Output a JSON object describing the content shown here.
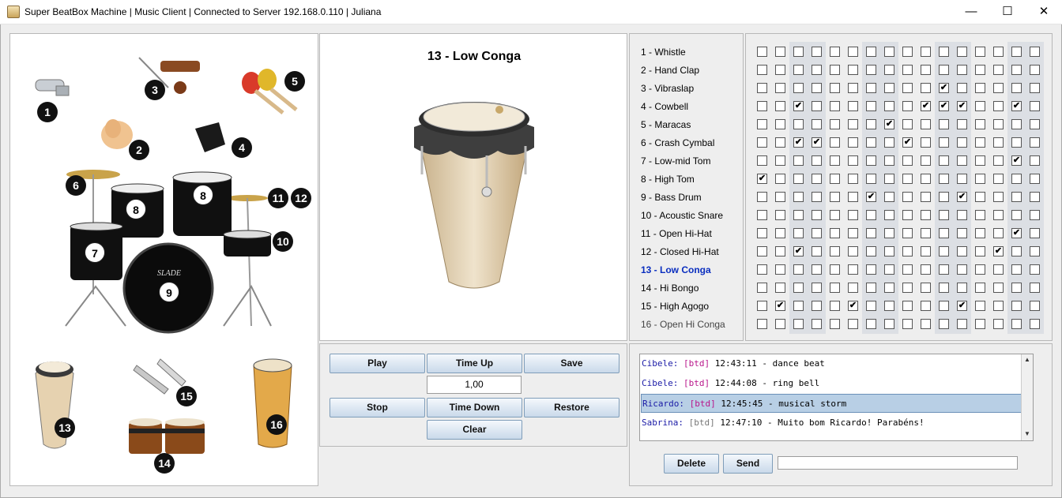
{
  "window": {
    "title": "Super BeatBox Machine | Music Client | Connected to Server 192.168.0.110 | Juliana",
    "minimize": "—",
    "maximize": "☐",
    "close": "✕"
  },
  "instrument_map": {
    "numbers": [
      "1",
      "2",
      "3",
      "4",
      "5",
      "6",
      "7",
      "8",
      "8",
      "9",
      "10",
      "11",
      "12",
      "13",
      "14",
      "15",
      "16"
    ],
    "drum_logo": "SLADE"
  },
  "preview": {
    "title": "13 - Low Conga"
  },
  "controls": {
    "play": "Play",
    "time_up": "Time Up",
    "save": "Save",
    "tempo": "1,00",
    "stop": "Stop",
    "time_down": "Time Down",
    "restore": "Restore",
    "clear": "Clear"
  },
  "instruments": [
    "1 - Whistle",
    "2 - Hand Clap",
    "3 - Vibraslap",
    "4 - Cowbell",
    "5 - Maracas",
    "6 - Crash Cymbal",
    "7 - Low-mid Tom",
    "8 - High Tom",
    "9 - Bass Drum",
    "10 - Acoustic Snare",
    "11 - Open Hi-Hat",
    "12 - Closed Hi-Hat",
    "13 - Low Conga",
    "14 - Hi Bongo",
    "15 - High Agogo",
    "16 - Open Hi Conga"
  ],
  "selected_instrument": "13 - Low Conga",
  "checked_glyph": "✔",
  "grid_checked": [
    [],
    [],
    [
      10
    ],
    [
      2,
      9,
      10,
      11,
      14
    ],
    [
      7
    ],
    [
      2,
      3,
      8
    ],
    [
      14
    ],
    [
      0
    ],
    [
      6,
      11
    ],
    [],
    [
      14
    ],
    [
      2,
      13
    ],
    [],
    [],
    [
      1,
      5,
      11
    ],
    []
  ],
  "chat": {
    "messages": [
      {
        "sender": "Cibele:",
        "tag": "[btd]",
        "text": "12:43:11 - dance beat"
      },
      {
        "sender": "Cibele:",
        "tag": "[btd]",
        "text": "12:44:08 - ring bell"
      },
      {
        "sender": "Ricardo:",
        "tag": "[btd]",
        "text": "12:45:45 - musical storm"
      },
      {
        "sender": "Sabrina:",
        "tag": "[btd]",
        "text": "12:47:10 - Muito bom Ricardo! Parabéns!"
      }
    ],
    "selected_index": 2,
    "delete": "Delete",
    "send": "Send",
    "input_value": ""
  },
  "colors": {
    "sender": "#1a1aa6",
    "tag": "#b8168b",
    "selection": "#b8cfe5",
    "selected_instrument": "#0a2ebf"
  }
}
